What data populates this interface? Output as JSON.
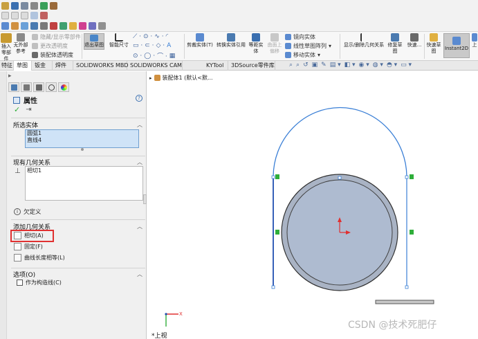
{
  "ribbon": {
    "buttons": {
      "exit_sketch": "退出草图",
      "smart_dim": "智能尺寸",
      "trim": "剪裁实体(T)",
      "convert": "转换实体引用",
      "offset": "等距实体",
      "surface_offset": "曲面上偏移",
      "mirror": "镜向实体",
      "linear_pattern": "线性草图阵列",
      "move": "移动实体",
      "show_hide_rel": "显示/删除几何关系",
      "repair": "修复草图",
      "quick_snap": "快速...",
      "rapid_sketch": "快速草图",
      "instant2d": "Instant2D",
      "upper": "上"
    },
    "left_labels": {
      "insert_part": "插入零部件",
      "no_external": "无外部参考",
      "show_hide_parts": "隐藏/显示零部件",
      "change_transparency": "更改透明度",
      "assembly_transparency": "装配体透明度"
    }
  },
  "tabs": [
    {
      "label": "特征"
    },
    {
      "label": "草图",
      "active": true
    },
    {
      "label": "钣金"
    },
    {
      "label": "焊件"
    },
    {
      "label": "SOLIDWORKS MBD"
    },
    {
      "label": "SOLIDWORKS CAM"
    },
    {
      "label": "KYTool"
    },
    {
      "label": "3DSource零件库"
    }
  ],
  "tree": {
    "root": "装配体1 (默认<默..."
  },
  "panel": {
    "title": "属性",
    "help": "?",
    "selected_entities": {
      "title": "所选实体",
      "items": [
        "圆弧1",
        "直线4"
      ]
    },
    "existing_relations": {
      "title": "现有几何关系",
      "items": [
        "相切1"
      ],
      "status": "欠定义"
    },
    "add_relations": {
      "title": "添加几何关系",
      "items": [
        "相切(A)",
        "固定(F)",
        "曲线长度相等(L)"
      ]
    },
    "options": {
      "title": "选项(O)",
      "construction": "作为构造线(C)"
    }
  },
  "view": {
    "orientation": "*上视"
  },
  "watermark": "CSDN @技术死肥仔",
  "colors": {
    "sketch_blue": "#3a7fd6",
    "circle_fill": "#a9b3c4",
    "highlight_red": "#e03030",
    "relation_green": "#2fae3a"
  }
}
